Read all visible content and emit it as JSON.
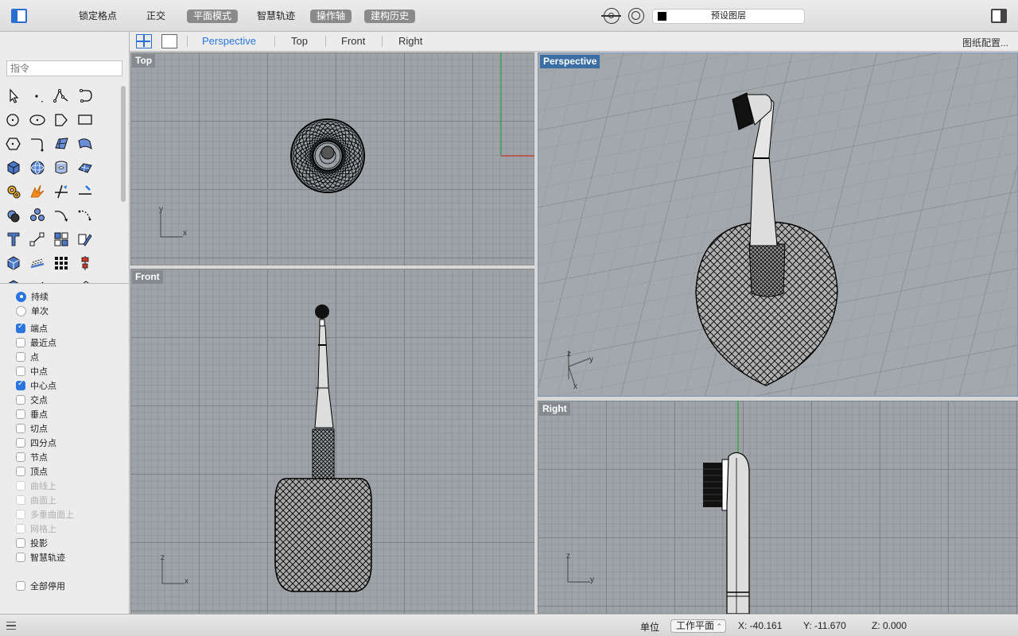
{
  "toolbar": {
    "buttons": [
      {
        "label": "锁定格点",
        "active": false
      },
      {
        "label": "正交",
        "active": false
      },
      {
        "label": "平面模式",
        "active": true
      },
      {
        "label": "智慧轨迹",
        "active": false
      },
      {
        "label": "操作轴",
        "active": true
      },
      {
        "label": "建构历史",
        "active": true
      }
    ],
    "layer": "预设图层",
    "layer_color": "#000000"
  },
  "command": {
    "placeholder": "指令"
  },
  "view_tabs": {
    "tabs": [
      "Perspective",
      "Top",
      "Front",
      "Right"
    ],
    "active": "Perspective",
    "config": "图纸配置..."
  },
  "viewports": {
    "top": "Top",
    "perspective": "Perspective",
    "front": "Front",
    "right": "Right"
  },
  "axes": {
    "x": "x",
    "y": "y",
    "z": "z"
  },
  "osnap": {
    "mode": [
      {
        "label": "持续",
        "checked": true
      },
      {
        "label": "单次",
        "checked": false
      }
    ],
    "items": [
      {
        "label": "端点",
        "checked": true,
        "disabled": false
      },
      {
        "label": "最近点",
        "checked": false,
        "disabled": false
      },
      {
        "label": "点",
        "checked": false,
        "disabled": false
      },
      {
        "label": "中点",
        "checked": false,
        "disabled": false
      },
      {
        "label": "中心点",
        "checked": true,
        "disabled": false
      },
      {
        "label": "交点",
        "checked": false,
        "disabled": false
      },
      {
        "label": "垂点",
        "checked": false,
        "disabled": false
      },
      {
        "label": "切点",
        "checked": false,
        "disabled": false
      },
      {
        "label": "四分点",
        "checked": false,
        "disabled": false
      },
      {
        "label": "节点",
        "checked": false,
        "disabled": false
      },
      {
        "label": "顶点",
        "checked": false,
        "disabled": false
      },
      {
        "label": "曲线上",
        "checked": false,
        "disabled": true
      },
      {
        "label": "曲面上",
        "checked": false,
        "disabled": true
      },
      {
        "label": "多重曲面上",
        "checked": false,
        "disabled": true
      },
      {
        "label": "网格上",
        "checked": false,
        "disabled": true
      },
      {
        "label": "投影",
        "checked": false,
        "disabled": false
      },
      {
        "label": "智慧轨迹",
        "checked": false,
        "disabled": false
      }
    ],
    "disable_all": "全部停用"
  },
  "status": {
    "units_label": "单位",
    "cplane": "工作平面",
    "x": "X: -40.161",
    "y": "Y: -11.670",
    "z": "Z: 0.000"
  },
  "colors": {
    "accent": "#2a76e0",
    "viewport_bg": "#9ea3a8",
    "active_label": "#3a6ea5",
    "x_axis": "#c0392b",
    "y_axis": "#2e9e3e"
  }
}
